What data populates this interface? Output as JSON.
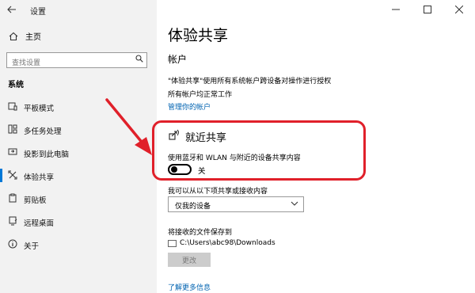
{
  "window": {
    "title": "设置",
    "controls": [
      "minimize-icon",
      "maximize-icon",
      "close-icon"
    ]
  },
  "sidebar": {
    "home_label": "主页",
    "search_placeholder": "查找设置",
    "section_title": "系统",
    "items": [
      {
        "label": "平板模式",
        "icon": "tablet-mode-icon"
      },
      {
        "label": "多任务处理",
        "icon": "multitasking-icon"
      },
      {
        "label": "投影到此电脑",
        "icon": "project-icon"
      },
      {
        "label": "体验共享",
        "icon": "shared-experiences-icon",
        "active": true
      },
      {
        "label": "剪贴板",
        "icon": "clipboard-icon"
      },
      {
        "label": "远程桌面",
        "icon": "remote-desktop-icon"
      },
      {
        "label": "关于",
        "icon": "about-icon"
      }
    ]
  },
  "main": {
    "title": "体验共享",
    "account_heading": "帐户",
    "account_desc1": "\"体验共享\"使用所有系统帐户跨设备对操作进行授权",
    "account_desc2": "所有帐户均正常工作",
    "manage_link": "管理你的帐户",
    "nearby_heading": "就近共享",
    "nearby_desc": "使用蓝牙和 WLAN 与附近的设备共享内容",
    "toggle_state": "关",
    "toggle_on": false,
    "share_label": "我可以从以下项共享或接收内容",
    "dropdown_value": "仅我的设备",
    "save_label": "将接收的文件保存到",
    "save_path": "C:\\Users\\abc98\\Downloads",
    "change_button": "更改",
    "learn_more_link": "了解更多信息"
  },
  "colors": {
    "accent": "#0078d7",
    "link": "#0063b1",
    "annotation": "#e0202a",
    "sidebar_bg": "#f2f2f2"
  }
}
